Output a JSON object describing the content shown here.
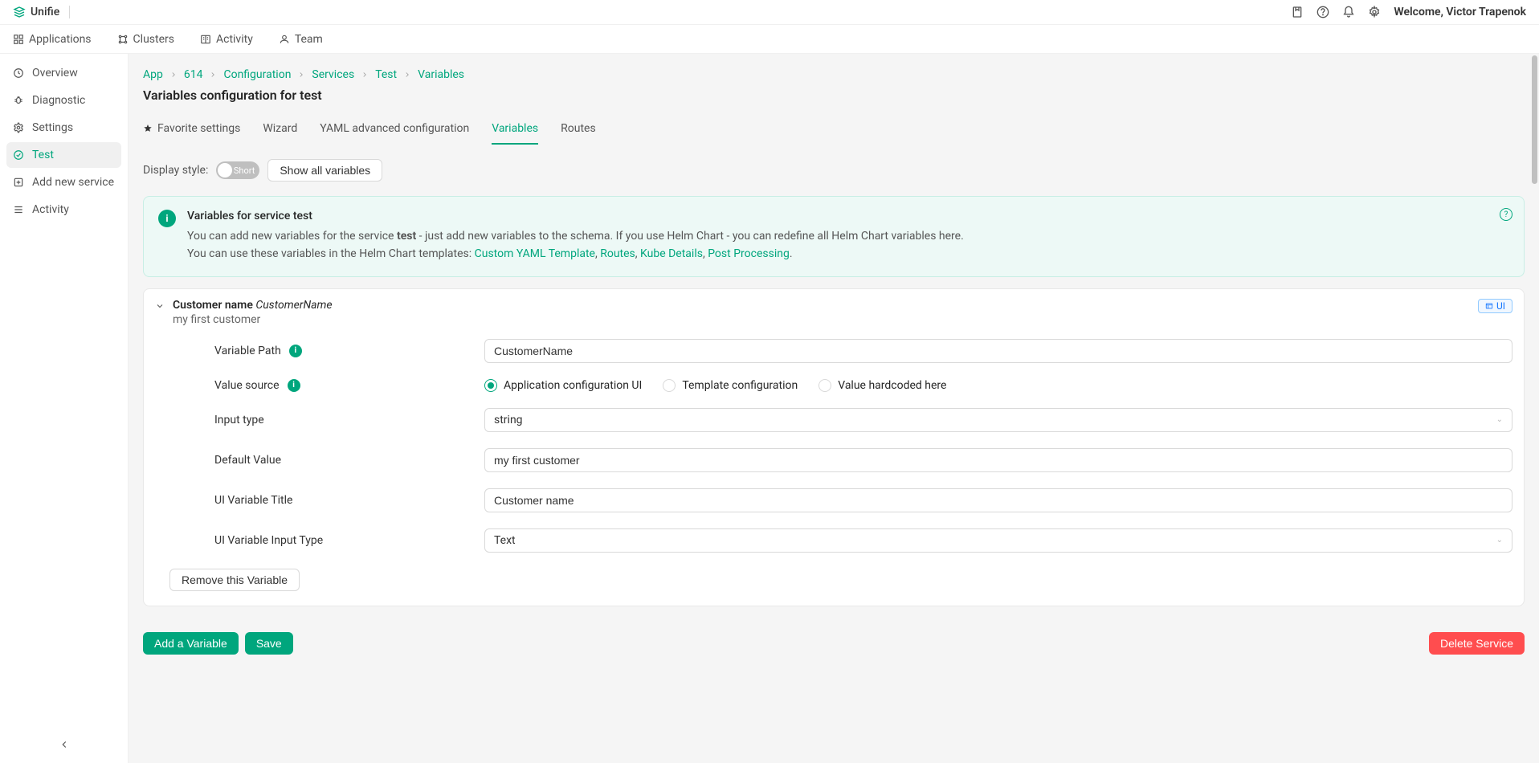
{
  "header": {
    "brand": "Unifie",
    "welcome": "Welcome, Victor Trapenok"
  },
  "topnav": [
    "Applications",
    "Clusters",
    "Activity",
    "Team"
  ],
  "sidebar": {
    "items": [
      {
        "label": "Overview"
      },
      {
        "label": "Diagnostic"
      },
      {
        "label": "Settings"
      },
      {
        "label": "Test"
      },
      {
        "label": "Add new service"
      },
      {
        "label": "Activity"
      }
    ]
  },
  "breadcrumbs": [
    "App",
    "614",
    "Configuration",
    "Services",
    "Test",
    "Variables"
  ],
  "page_title": "Variables configuration for test",
  "tabs": [
    "Favorite settings",
    "Wizard",
    "YAML advanced configuration",
    "Variables",
    "Routes"
  ],
  "controls": {
    "display_style_label": "Display style:",
    "toggle_text": "Short",
    "show_all": "Show all variables"
  },
  "alert": {
    "title": "Variables for service test",
    "line1_pre": "You can add new variables for the service ",
    "line1_bold": "test",
    "line1_post": " - just add new variables to the schema. If you use Helm Chart - you can redefine all Helm Chart variables here.",
    "line2_pre": "You can use these variables in the Helm Chart templates: ",
    "links": [
      "Custom YAML Template",
      "Routes",
      "Kube Details",
      "Post Processing"
    ]
  },
  "panel": {
    "title": "Customer name",
    "title_var": "CustomerName",
    "subtitle": "my first customer",
    "ui_badge": "UI"
  },
  "form": {
    "variable_path": {
      "label": "Variable Path",
      "value": "CustomerName"
    },
    "value_source": {
      "label": "Value source",
      "options": [
        "Application configuration UI",
        "Template configuration",
        "Value hardcoded here"
      ],
      "selected": 0
    },
    "input_type": {
      "label": "Input type",
      "value": "string"
    },
    "default_value": {
      "label": "Default Value",
      "value": "my first customer"
    },
    "ui_title": {
      "label": "UI Variable Title",
      "value": "Customer name"
    },
    "ui_input_type": {
      "label": "UI Variable Input Type",
      "value": "Text"
    },
    "remove": "Remove this Variable"
  },
  "footer": {
    "add": "Add a Variable",
    "save": "Save",
    "delete": "Delete Service"
  }
}
